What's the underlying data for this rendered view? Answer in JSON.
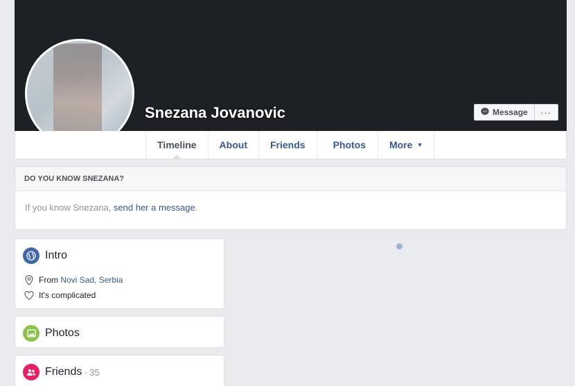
{
  "profile": {
    "name": "Snezana Jovanovic",
    "message_label": "Message",
    "more_label": "···"
  },
  "tabs": [
    {
      "label": "Timeline",
      "active": true
    },
    {
      "label": "About"
    },
    {
      "label": "Friends"
    },
    {
      "label": "Photos"
    },
    {
      "label": "More",
      "caret": "▼"
    }
  ],
  "know": {
    "heading": "DO YOU KNOW SNEZANA?",
    "text_prefix": "If you know Snezana, ",
    "link": "send her a message",
    "text_suffix": "."
  },
  "intro": {
    "title": "Intro",
    "from_prefix": "From ",
    "from_place": "Novi Sad, Serbia",
    "relationship": "It's complicated"
  },
  "photos": {
    "title": "Photos"
  },
  "friends": {
    "title": "Friends",
    "count": "· 35"
  },
  "colors": {
    "cover": "#1d2024",
    "link": "#365899",
    "intro_icon": "#4267b2",
    "photos_icon": "#8bc34a",
    "friends_icon": "#e91e63"
  }
}
